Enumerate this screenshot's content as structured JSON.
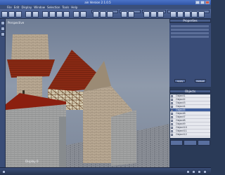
{
  "window": {
    "title": "ain Version 2.1.0.5"
  },
  "menu": {
    "items": [
      "File",
      "Edit",
      "Display",
      "Window",
      "Selection",
      "Tools",
      "Help"
    ]
  },
  "viewport": {
    "label": "Perspective",
    "footer": "Display 0"
  },
  "right_panel": {
    "params_title": "Properties",
    "buttons": [
      "Apply",
      "Default"
    ],
    "objects_title": "Objects",
    "objects": [
      {
        "name": "Object1",
        "selected": false
      },
      {
        "name": "Object2",
        "selected": false
      },
      {
        "name": "Object3",
        "selected": false
      },
      {
        "name": "Object4",
        "selected": false
      },
      {
        "name": "Object5",
        "selected": true
      },
      {
        "name": "Object6",
        "selected": false
      },
      {
        "name": "Object7",
        "selected": false
      },
      {
        "name": "Object8",
        "selected": false
      },
      {
        "name": "Object9",
        "selected": false
      },
      {
        "name": "Object10",
        "selected": false
      },
      {
        "name": "Object11",
        "selected": false
      },
      {
        "name": "Object12",
        "selected": false
      }
    ]
  },
  "colors": {
    "accent": "#3f5f9e",
    "panel": "#3a4d78",
    "roof": "#8a2a14"
  }
}
